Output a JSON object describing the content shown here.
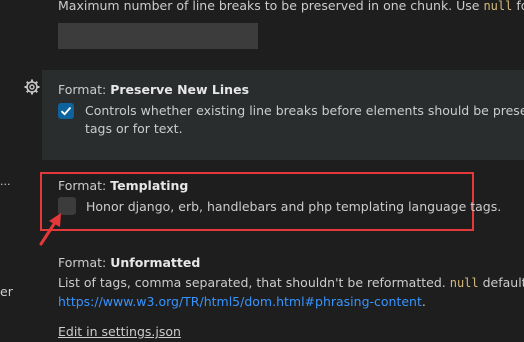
{
  "top_setting": {
    "desc_prefix": "Maximum number of line breaks to be preserved in one chunk. Use ",
    "desc_code": "null",
    "desc_suffix": " for unlim"
  },
  "preserve_new_lines": {
    "category": "Format: ",
    "name": "Preserve New Lines",
    "checked": true,
    "desc_line1": "Controls whether existing line breaks before elements should be preserved. O",
    "desc_line2": "tags or for text."
  },
  "templating": {
    "category": "Format: ",
    "name": "Templating",
    "checked": false,
    "desc": "Honor django, erb, handlebars and php templating language tags."
  },
  "unformatted": {
    "category": "Format: ",
    "name": "Unformatted",
    "desc_prefix": "List of tags, comma separated, that shouldn't be reformatted. ",
    "desc_code": "null",
    "desc_suffix": " defaults to all",
    "link": "https://www.w3.org/TR/html5/dom.html#phrasing-content",
    "link_suffix": ".",
    "edit_link": "Edit in settings.json"
  },
  "left_sidebar": {
    "ellipsis": "...",
    "partial": "er"
  },
  "colors": {
    "highlight": "#e5383b",
    "checkbox_on": "#0e639c",
    "link": "#3794ff"
  }
}
